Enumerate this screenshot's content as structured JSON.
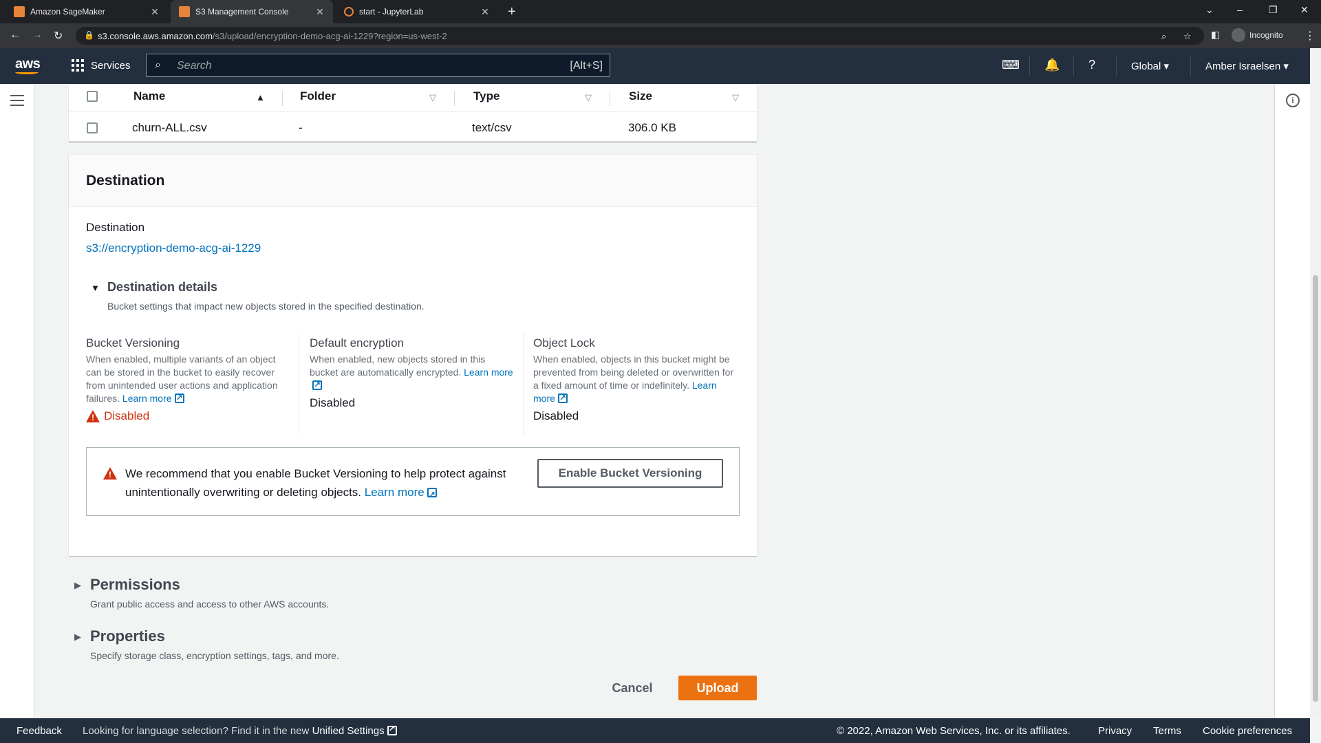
{
  "browser": {
    "tabs": [
      {
        "title": "Amazon SageMaker"
      },
      {
        "title": "S3 Management Console"
      },
      {
        "title": "start - JupyterLab"
      }
    ],
    "url_host": "s3.console.aws.amazon.com",
    "url_path": "/s3/upload/encryption-demo-acg-ai-1229?region=us-west-2",
    "incognito_label": "Incognito"
  },
  "header": {
    "logo": "aws",
    "services_label": "Services",
    "search_placeholder": "Search",
    "search_shortcut": "[Alt+S]",
    "region": "Global",
    "user": "Amber Israelsen"
  },
  "files_table": {
    "columns": [
      "Name",
      "Folder",
      "Type",
      "Size"
    ],
    "rows": [
      {
        "name": "churn-ALL.csv",
        "folder": "-",
        "type": "text/csv",
        "size": "306.0 KB"
      }
    ]
  },
  "destination": {
    "heading": "Destination",
    "label": "Destination",
    "link": "s3://encryption-demo-acg-ai-1229",
    "details_title": "Destination details",
    "details_desc": "Bucket settings that impact new objects stored in the specified destination.",
    "columns": [
      {
        "title": "Bucket Versioning",
        "desc": "When enabled, multiple variants of an object can be stored in the bucket to easily recover from unintended user actions and application failures.",
        "learn_more": "Learn more",
        "value": "Disabled"
      },
      {
        "title": "Default encryption",
        "desc": "When enabled, new objects stored in this bucket are automatically encrypted.",
        "learn_more": "Learn more",
        "value": "Disabled"
      },
      {
        "title": "Object Lock",
        "desc": "When enabled, objects in this bucket might be prevented from being deleted or overwritten for a fixed amount of time or indefinitely.",
        "learn_more": "Learn more",
        "value": "Disabled"
      }
    ],
    "alert_text": "We recommend that you enable Bucket Versioning to help protect against unintentionally overwriting or deleting objects.",
    "alert_learn_more": "Learn more",
    "enable_button": "Enable Bucket Versioning"
  },
  "sections": [
    {
      "title": "Permissions",
      "desc": "Grant public access and access to other AWS accounts."
    },
    {
      "title": "Properties",
      "desc": "Specify storage class, encryption settings, tags, and more."
    }
  ],
  "actions": {
    "cancel": "Cancel",
    "upload": "Upload"
  },
  "footer": {
    "feedback": "Feedback",
    "lang_text": "Looking for language selection? Find it in the new",
    "unified_settings": "Unified Settings",
    "copyright": "© 2022, Amazon Web Services, Inc. or its affiliates.",
    "privacy": "Privacy",
    "terms": "Terms",
    "cookies": "Cookie preferences"
  },
  "colors": {
    "accent": "#ec7211",
    "link": "#0073bb",
    "header": "#232f3e",
    "warning": "#d13212"
  }
}
